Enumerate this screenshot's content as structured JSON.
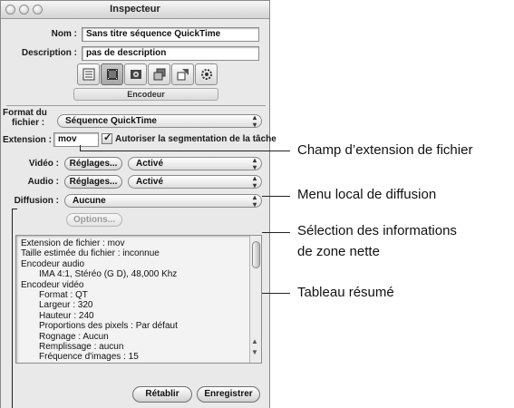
{
  "window": {
    "title": "Inspecteur"
  },
  "name": {
    "label": "Nom :",
    "value": "Sans titre séquence QuickTime"
  },
  "description": {
    "label": "Description :",
    "value": "pas de description"
  },
  "tab_bar": {
    "icons": [
      "summary-tab-icon",
      "encoder-tab-icon",
      "frame-controls-tab-icon",
      "filters-tab-icon",
      "geometry-tab-icon",
      "actions-tab-icon"
    ],
    "selected_index": 1,
    "active_tab_label": "Encodeur"
  },
  "format": {
    "label_line1": "Format du",
    "label_line2": "fichier :",
    "value": "Séquence QuickTime"
  },
  "extension": {
    "label": "Extension :",
    "value": "mov",
    "segmentation_label": "Autoriser la segmentation de la tâche",
    "segmentation_checked": true
  },
  "video": {
    "label": "Vidéo :",
    "settings_button": "Réglages...",
    "state": "Activé"
  },
  "audio": {
    "label": "Audio :",
    "settings_button": "Réglages...",
    "state": "Activé"
  },
  "streaming": {
    "label": "Diffusion :",
    "value": "Aucune",
    "options_button": "Options..."
  },
  "summary_lines": [
    {
      "text": "Extension de fichier : mov",
      "indent": false
    },
    {
      "text": "Taille estimée du fichier : inconnue",
      "indent": false
    },
    {
      "text": "Encodeur audio",
      "indent": false
    },
    {
      "text": "IMA 4:1, Stéréo (G D), 48,000 Khz",
      "indent": true
    },
    {
      "text": "Encodeur vidéo",
      "indent": false
    },
    {
      "text": "Format : QT",
      "indent": true
    },
    {
      "text": "Largeur : 320",
      "indent": true
    },
    {
      "text": "Hauteur : 240",
      "indent": true
    },
    {
      "text": "Proportions des pixels : Par défaut",
      "indent": true
    },
    {
      "text": "Rognage : Aucun",
      "indent": true
    },
    {
      "text": "Remplissage : aucun",
      "indent": true
    },
    {
      "text": "Fréquence d'images : 15",
      "indent": true
    }
  ],
  "buttons": {
    "revert": "Rétablir",
    "save": "Enregistrer"
  },
  "annotations": {
    "extension_field": "Champ d’extension de fichier",
    "streaming_menu": "Menu local de diffusion",
    "selection_line1": "Sélection des informations",
    "selection_line2": "de zone nette",
    "summary_table": "Tableau résumé"
  }
}
